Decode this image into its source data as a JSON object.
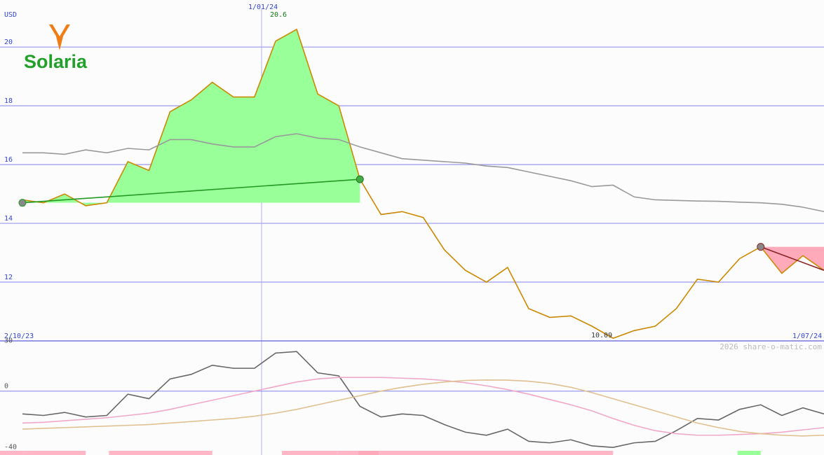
{
  "chart_data": [
    {
      "type": "line",
      "currency_label": "USD",
      "x_start_label": "2/10/23",
      "x_mid_label": "1/01/24",
      "x_end_label": "1/07/24",
      "yticks": [
        12,
        14,
        16,
        18,
        20
      ],
      "ylim": [
        10.0,
        21.6
      ],
      "x": [
        0,
        1,
        2,
        3,
        4,
        5,
        6,
        7,
        8,
        9,
        10,
        11,
        12,
        13,
        14,
        15,
        16,
        17,
        18,
        19,
        20,
        21,
        22,
        23,
        24,
        25,
        26,
        27,
        28,
        29,
        30,
        31,
        32,
        33,
        34,
        35,
        36,
        37,
        38
      ],
      "series": [
        {
          "role": "price",
          "color": "#cc8800",
          "values": [
            14.8,
            14.7,
            15.0,
            14.6,
            14.7,
            16.1,
            15.8,
            17.8,
            18.2,
            18.8,
            18.3,
            18.3,
            20.2,
            20.6,
            18.4,
            18.0,
            15.5,
            14.3,
            14.4,
            14.2,
            13.1,
            12.4,
            12.0,
            12.5,
            11.1,
            10.8,
            10.85,
            10.5,
            10.09,
            10.35,
            10.5,
            11.1,
            12.1,
            12.0,
            12.8,
            13.2,
            12.3,
            12.9,
            12.4
          ]
        },
        {
          "role": "moving-average",
          "color": "#999999",
          "values": [
            16.4,
            16.4,
            16.35,
            16.5,
            16.4,
            16.55,
            16.5,
            16.85,
            16.85,
            16.7,
            16.6,
            16.6,
            16.95,
            17.05,
            16.9,
            16.85,
            16.6,
            16.4,
            16.2,
            16.15,
            16.1,
            16.05,
            15.95,
            15.9,
            15.75,
            15.6,
            15.45,
            15.25,
            15.3,
            14.9,
            14.8,
            14.78,
            14.76,
            14.75,
            14.72,
            14.7,
            14.65,
            14.55,
            14.4
          ]
        }
      ],
      "annotations": {
        "high_label": "20.6",
        "low_label": "10.09",
        "copyright": "2026 share-o-matic.com",
        "trend_up": {
          "from_index": 0,
          "from_value": 14.7,
          "to_index": 16,
          "to_value": 15.5,
          "color": "#229922",
          "fill": "#99ff99"
        },
        "trend_down": {
          "from_index": 35,
          "from_value": 13.2,
          "to_index": 38,
          "to_value": 12.4,
          "color": "#882222",
          "fill": "#ffaabb"
        }
      }
    },
    {
      "type": "line",
      "yticks": [
        30,
        0,
        -40
      ],
      "ylim": [
        -42,
        33
      ],
      "x": [
        0,
        1,
        2,
        3,
        4,
        5,
        6,
        7,
        8,
        9,
        10,
        11,
        12,
        13,
        14,
        15,
        16,
        17,
        18,
        19,
        20,
        21,
        22,
        23,
        24,
        25,
        26,
        27,
        28,
        29,
        30,
        31,
        32,
        33,
        34,
        35,
        36,
        37,
        38
      ],
      "series": [
        {
          "role": "oscillator",
          "color": "#666666",
          "values": [
            -15,
            -16,
            -14,
            -17,
            -16,
            -2,
            -5,
            8,
            11,
            17,
            15,
            15,
            25,
            26,
            12,
            10,
            -10,
            -17,
            -15,
            -16,
            -22,
            -27,
            -29,
            -25,
            -33,
            -34,
            -32,
            -36,
            -37,
            -34,
            -33,
            -26,
            -18,
            -19,
            -12,
            -9,
            -16,
            -11,
            -15
          ]
        },
        {
          "role": "smoothed-1",
          "color": "#f0a8c8",
          "values": [
            -21,
            -20.5,
            -19.5,
            -18.5,
            -17.5,
            -16,
            -14.5,
            -12,
            -9,
            -6,
            -3,
            0,
            3,
            6,
            8,
            9,
            9,
            9,
            8.5,
            8,
            7,
            5.5,
            3.5,
            1,
            -2,
            -5.5,
            -9,
            -13,
            -18,
            -22.5,
            -26,
            -28,
            -29,
            -29,
            -28.5,
            -28,
            -27,
            -25.5,
            -24
          ]
        },
        {
          "role": "smoothed-2",
          "color": "#e0c090",
          "values": [
            -25,
            -24.5,
            -24,
            -23.5,
            -23,
            -22.5,
            -22,
            -21,
            -20,
            -19,
            -18,
            -16.5,
            -14.5,
            -12,
            -9,
            -6,
            -3,
            0,
            2.5,
            4.5,
            6,
            7,
            7.3,
            7.2,
            6.5,
            5,
            2.5,
            -1,
            -5,
            -9,
            -13,
            -17,
            -21,
            -24,
            -26.5,
            -28,
            -29,
            -29.5,
            -29
          ]
        }
      ],
      "volume_bars": [
        {
          "from": 0,
          "to": 0.06,
          "color": "#ffb6c6"
        },
        {
          "from": 0.06,
          "to": 3.0,
          "color": "#ffb6c6"
        },
        {
          "from": 4.1,
          "to": 9.0,
          "color": "#ffb6c6"
        },
        {
          "from": 12.3,
          "to": 14.9,
          "color": "#ffb6c6"
        },
        {
          "from": 14.9,
          "to": 15.9,
          "color": "#ffb6c6"
        },
        {
          "from": 15.9,
          "to": 16.9,
          "color": "#ffaabb"
        },
        {
          "from": 16.9,
          "to": 28.0,
          "color": "#ffb6c6"
        },
        {
          "from": 33.9,
          "to": 35.0,
          "color": "#99ff99"
        }
      ]
    }
  ],
  "logo": {
    "name": "Solaria",
    "mark_color": "#f07c16",
    "text_color": "#22a02a"
  },
  "colors": {
    "grid": "#9999ee",
    "axis_text": "#3344cc",
    "high_text": "#117711",
    "low_text": "#333333",
    "copyright_text": "#bbbbbb",
    "divider": "#7777dd"
  }
}
